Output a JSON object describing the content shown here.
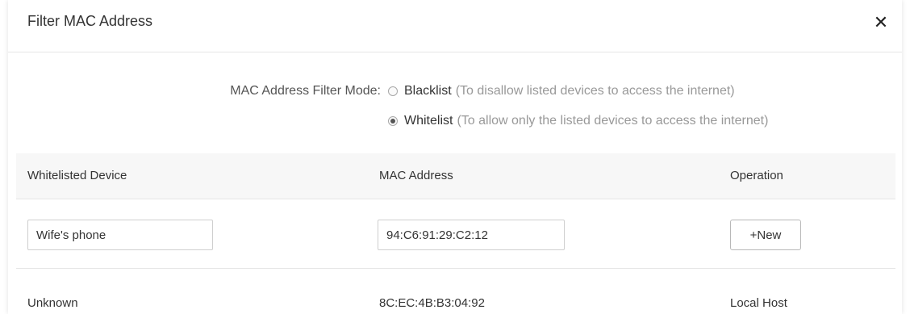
{
  "dialog": {
    "title": "Filter MAC Address",
    "close_symbol": "✕"
  },
  "filter_mode": {
    "label": "MAC Address Filter Mode:",
    "selected": "Whitelist",
    "options": [
      {
        "name": "Blacklist",
        "description": "(To disallow listed devices to access the internet)",
        "checked": false
      },
      {
        "name": "Whitelist",
        "description": "(To allow only the listed devices to access the internet)",
        "checked": true
      }
    ]
  },
  "table": {
    "columns": [
      "Whitelisted Device",
      "MAC Address",
      "Operation"
    ],
    "new_row": {
      "device_value": "Wife's phone",
      "mac_value": "94:C6:91:29:C2:12",
      "button_label": "+New"
    },
    "rows": [
      {
        "device": "Unknown",
        "mac": "8C:EC:4B:B3:04:92",
        "operation": "Local Host"
      }
    ]
  },
  "icons": {
    "close": "close-icon",
    "radio": "radio-button"
  }
}
